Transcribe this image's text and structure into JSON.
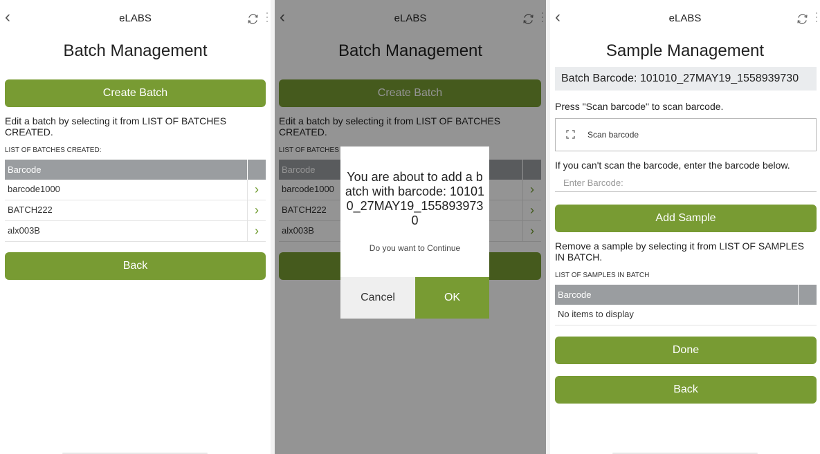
{
  "app_title": "eLABS",
  "screen1": {
    "heading": "Batch Management",
    "create_button": "Create Batch",
    "instruction": "Edit a batch by selecting it from LIST OF BATCHES CREATED.",
    "list_caption": "LIST OF BATCHES CREATED:",
    "table_header": "Barcode",
    "rows": [
      "barcode1000",
      "BATCH222",
      "alx003B"
    ],
    "back_button": "Back"
  },
  "screen2": {
    "heading": "Batch Management",
    "create_button": "Create Batch",
    "instruction": "Edit a batch by selecting it from LIST OF BATCHES CREATED.",
    "list_caption": "LIST OF BATCHES",
    "table_header": "Barcode",
    "rows": [
      "barcode1000",
      "BATCH222",
      "alx003B"
    ],
    "dialog": {
      "message": "You are about to add a batch with barcode: 101010_27MAY19_1558939730",
      "question": "Do you want to Continue",
      "cancel_label": "Cancel",
      "ok_label": "OK"
    }
  },
  "screen3": {
    "heading": "Sample Management",
    "batch_barcode": "Batch Barcode: 101010_27MAY19_1558939730",
    "scan_instruction": "Press \"Scan barcode\" to scan barcode.",
    "scan_label": "Scan barcode",
    "manual_instruction": "If you can't scan the barcode, enter the barcode below.",
    "barcode_placeholder": "Enter Barcode:",
    "add_button": "Add Sample",
    "remove_instruction": "Remove a sample by selecting it from LIST OF SAMPLES IN BATCH.",
    "list_caption": "LIST OF SAMPLES IN BATCH",
    "table_header": "Barcode",
    "empty_text": "No items to display",
    "done_button": "Done",
    "back_button": "Back"
  },
  "icons": {
    "back": "chevron-left-icon",
    "sync": "sync-icon",
    "menu": "kebab-menu-icon",
    "row": "chevron-right-icon",
    "scan": "scan-frame-icon"
  },
  "colors": {
    "accent": "#789b33",
    "header_gray": "#9a9da0",
    "chevron": "#6e9a2c"
  }
}
